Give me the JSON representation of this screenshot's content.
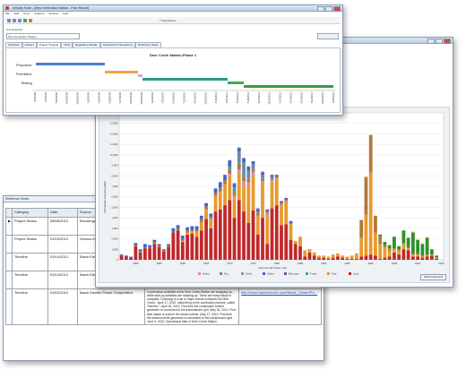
{
  "front_window": {
    "title": "Velocity Suite - [New Generation Station - Prior Report]",
    "menu": [
      "File",
      "Edit",
      "Tools",
      "Analysis",
      "Window",
      "Help"
    ],
    "toolbar": {
      "station_field": "New Generation Station",
      "help_label": "? Help Report"
    },
    "subtitle_label": "Unit Selected",
    "tabs": [
      "Overview",
      "Owners",
      "Project Timeline",
      "Units",
      "Regulatory Details",
      "Contracts & Transactions",
      "Reference Notes"
    ],
    "gantt": {
      "title": "Deer Creek Station-Phase 1",
      "rows": [
        "Proposed",
        "Permitted",
        "Testing"
      ],
      "dates": [
        "4/3/2008",
        "6/1/2008",
        "7/30/2008",
        "9/29/2008",
        "11/28/2008",
        "1/28/2009",
        "3/29/2009",
        "5/28/2009",
        "7/27/2009",
        "9/25/2009",
        "11/24/2009",
        "1/24/2010",
        "3/25/2010",
        "5/24/2010",
        "7/23/2010",
        "9/21/2010",
        "11/20/2010",
        "1/19/2011",
        "3/20/2011",
        "5/19/2011",
        "7/18/2011",
        "9/16/2011",
        "11/15/2011",
        "1/14/2012",
        "3/14/2012",
        "5/13/2012",
        "7/12/2012",
        "9/10/2012",
        "11/9/2012"
      ],
      "colors": {
        "proposed": "#4a7fd0",
        "permitted": "#eea24b",
        "permitted2": "#cfa7e0",
        "testing": "#2e9a8a",
        "testing2": "#3fae4a"
      }
    }
  },
  "back_window": {
    "chart_data": {
      "type": "bar",
      "ylabel": "Nameplate Capacity (MW)",
      "xlabel": "Commercial Online Year",
      "ylim": [
        0,
        14000
      ],
      "yticks": [
        0,
        1000,
        2000,
        3000,
        4000,
        5000,
        6000,
        7000,
        8000,
        9000,
        10000,
        11000,
        12000,
        13000,
        14000
      ],
      "xtick_labels": [
        "1950",
        "1955",
        "1960",
        "1965",
        "1970",
        "1975",
        "1980",
        "1985",
        "1990",
        "1995",
        "2000",
        "2005",
        "2010",
        "2015"
      ],
      "x": [
        1947,
        1948,
        1949,
        1950,
        1951,
        1952,
        1953,
        1954,
        1955,
        1956,
        1957,
        1958,
        1959,
        1960,
        1961,
        1962,
        1963,
        1964,
        1965,
        1966,
        1967,
        1968,
        1969,
        1970,
        1971,
        1972,
        1973,
        1974,
        1975,
        1976,
        1977,
        1978,
        1979,
        1980,
        1981,
        1982,
        1983,
        1984,
        1985,
        1986,
        1987,
        1988,
        1989,
        1990,
        1991,
        1992,
        1993,
        1994,
        1995,
        1996,
        1997,
        1998,
        1999,
        2000,
        2001,
        2002,
        2003,
        2004,
        2005,
        2006,
        2007,
        2008,
        2009,
        2010,
        2011,
        2012,
        2013,
        2014,
        2015
      ],
      "series": [
        {
          "name": "Coal",
          "color": "#c0282a",
          "values": [
            400,
            300,
            200,
            1300,
            700,
            1100,
            1100,
            1500,
            1200,
            800,
            1200,
            2600,
            2800,
            1700,
            2400,
            2500,
            2200,
            2800,
            3900,
            3000,
            4600,
            4800,
            5200,
            5700,
            4000,
            5700,
            4600,
            3500,
            4700,
            2400,
            4000,
            1500,
            4900,
            5200,
            3300,
            3400,
            1900,
            1500,
            1300,
            300,
            700,
            400,
            200,
            200,
            100,
            200,
            300,
            200,
            100,
            100,
            100,
            300,
            400,
            500,
            400,
            100,
            200,
            300,
            700,
            500,
            1000,
            900,
            300,
            300,
            200,
            300,
            400,
            100,
            0
          ]
        },
        {
          "name": "Gas",
          "color": "#e69a2e",
          "values": [
            0,
            0,
            0,
            0,
            0,
            0,
            0,
            0,
            0,
            0,
            0,
            0,
            0,
            100,
            200,
            200,
            500,
            800,
            900,
            900,
            1500,
            1700,
            2000,
            2300,
            1800,
            2500,
            2300,
            3500,
            3300,
            1800,
            3300,
            2600,
            2500,
            2600,
            2000,
            2200,
            1500,
            300,
            900,
            600,
            300,
            300,
            200,
            200,
            200,
            300,
            300,
            200,
            200,
            300,
            500,
            1800,
            3900,
            7800,
            2200,
            1400,
            1000,
            600,
            300,
            400,
            500,
            200,
            200,
            200,
            100,
            100,
            100,
            100,
            0
          ]
        },
        {
          "name": "Nuc",
          "color": "#d88f9a",
          "values": [
            0,
            0,
            0,
            0,
            0,
            0,
            0,
            0,
            0,
            0,
            0,
            0,
            0,
            0,
            0,
            0,
            0,
            0,
            0,
            0,
            0,
            0,
            0,
            200,
            300,
            400,
            600,
            400,
            400,
            0,
            200,
            300,
            200,
            0,
            0,
            0,
            0,
            0,
            0,
            0,
            0,
            0,
            0,
            0,
            0,
            0,
            0,
            0,
            0,
            0,
            0,
            0,
            0,
            0,
            0,
            0,
            0,
            0,
            0,
            0,
            0,
            0,
            0,
            0,
            0,
            0,
            0,
            0,
            0
          ]
        },
        {
          "name": "Oil",
          "color": "#b0783a",
          "values": [
            0,
            0,
            0,
            100,
            100,
            100,
            100,
            200,
            100,
            100,
            100,
            100,
            200,
            200,
            200,
            200,
            200,
            300,
            300,
            200,
            300,
            400,
            400,
            400,
            300,
            500,
            300,
            300,
            200,
            200,
            200,
            100,
            100,
            100,
            100,
            100,
            100,
            0,
            0,
            0,
            0,
            0,
            0,
            0,
            0,
            0,
            0,
            0,
            0,
            0,
            0,
            1700,
            3600,
            3600,
            1600,
            700,
            200,
            200,
            100,
            100,
            100,
            100,
            100,
            100,
            100,
            100,
            0,
            0,
            0
          ]
        },
        {
          "name": "Other",
          "color": "#6b8ca7",
          "values": [
            0,
            0,
            0,
            0,
            0,
            0,
            0,
            0,
            0,
            0,
            0,
            0,
            0,
            0,
            0,
            0,
            0,
            0,
            0,
            0,
            0,
            0,
            0,
            300,
            500,
            1200,
            1500,
            800,
            500,
            200,
            400,
            100,
            200,
            0,
            0,
            0,
            0,
            0,
            0,
            0,
            0,
            0,
            0,
            0,
            0,
            0,
            0,
            0,
            0,
            0,
            0,
            0,
            0,
            0,
            0,
            0,
            0,
            0,
            0,
            0,
            0,
            0,
            0,
            0,
            0,
            0,
            0,
            0,
            0
          ]
        },
        {
          "name": "Water",
          "color": "#3a66c8",
          "values": [
            100,
            100,
            100,
            200,
            200,
            300,
            200,
            200,
            200,
            100,
            200,
            300,
            300,
            300,
            300,
            300,
            300,
            300,
            300,
            300,
            400,
            400,
            400,
            500,
            300,
            300,
            300,
            300,
            200,
            200,
            200,
            100,
            100,
            100,
            100,
            100,
            100,
            0,
            0,
            0,
            0,
            0,
            0,
            0,
            0,
            0,
            0,
            0,
            0,
            0,
            0,
            0,
            0,
            0,
            0,
            0,
            0,
            0,
            0,
            0,
            0,
            0,
            0,
            0,
            0,
            0,
            0,
            0,
            0
          ]
        },
        {
          "name": "Biomass",
          "color": "#7e4f9e",
          "values": [
            0,
            0,
            0,
            0,
            0,
            0,
            0,
            0,
            0,
            0,
            0,
            0,
            0,
            0,
            0,
            0,
            0,
            0,
            0,
            0,
            0,
            100,
            100,
            100,
            100,
            100,
            100,
            100,
            100,
            100,
            100,
            100,
            100,
            100,
            100,
            100,
            100,
            0,
            0,
            0,
            0,
            0,
            0,
            0,
            0,
            0,
            0,
            0,
            0,
            0,
            0,
            0,
            0,
            0,
            0,
            0,
            0,
            0,
            0,
            0,
            0,
            0,
            0,
            0,
            0,
            0,
            0,
            0,
            0
          ]
        },
        {
          "name": "Wind",
          "color": "#2f8f2f",
          "values": [
            0,
            0,
            0,
            0,
            0,
            0,
            0,
            0,
            0,
            0,
            0,
            0,
            0,
            0,
            0,
            0,
            0,
            0,
            0,
            0,
            0,
            0,
            0,
            0,
            0,
            0,
            0,
            0,
            0,
            0,
            0,
            0,
            0,
            0,
            0,
            0,
            0,
            0,
            0,
            0,
            0,
            0,
            0,
            0,
            0,
            0,
            0,
            0,
            0,
            0,
            0,
            0,
            0,
            0,
            0,
            200,
            300,
            300,
            1100,
            300,
            1200,
            900,
            2000,
            1300,
            1100,
            1600,
            500,
            200,
            0
          ]
        },
        {
          "name": "Solar",
          "color": "#e8d64a",
          "values": [
            0,
            0,
            0,
            0,
            0,
            0,
            0,
            0,
            0,
            0,
            0,
            0,
            0,
            0,
            0,
            0,
            0,
            0,
            0,
            0,
            0,
            0,
            0,
            0,
            0,
            0,
            0,
            0,
            0,
            0,
            0,
            0,
            0,
            0,
            0,
            0,
            0,
            0,
            0,
            0,
            0,
            0,
            0,
            0,
            0,
            0,
            0,
            0,
            0,
            0,
            0,
            0,
            0,
            0,
            0,
            0,
            0,
            0,
            0,
            0,
            0,
            0,
            100,
            100,
            100,
            100,
            0,
            0,
            0
          ]
        }
      ],
      "legend_placement": "bottom"
    },
    "legend": [
      "Hydro",
      "Nuc",
      "Other",
      "Water",
      "Biomass",
      "Fuels",
      "Gas",
      "Coal"
    ],
    "legend_colors": [
      "#d888c8",
      "#6b8ca7",
      "#8b98a5",
      "#3a66c8",
      "#7e4f9e",
      "#4aa0c0",
      "#e69a2e",
      "#c0282a"
    ],
    "footer_button": "Show Data Grid"
  },
  "table_window": {
    "title": "Reference Notes",
    "columns": [
      "Category",
      "Date",
      "Source",
      "Notes",
      "Link"
    ],
    "rows": [
      {
        "category": "Project Status",
        "date": "08/08/2012",
        "source": "Brookings Regi",
        "notes": "",
        "link": ""
      },
      {
        "category": "Project Status",
        "date": "03/15/2012",
        "source": "Various Analyst",
        "notes": "",
        "link": ""
      },
      {
        "category": "Timeline",
        "date": "03/14/2012",
        "source": "Basin Electric Po",
        "notes": "",
        "link": ""
      },
      {
        "category": "Timeline",
        "date": "03/14/2012",
        "source": "Basin Electric P",
        "notes": "",
        "link": ""
      },
      {
        "category": "Timeline",
        "date": "03/02/2012",
        "source": "Basin Electric Power Cooperative",
        "notes": "Construction activities at the Deer Creek Station are wrapping up, while start-up activities are ramping-up. There are many steps to complete. Following is a list of major events scheduled at Deer Creek: -April 17, 2012: Initial firing of the combustion turbine, called \"first fire.\" -April 18, 2012: First time the combustion turbine generator is connected to the transmission grid -May 16, 2012: First time steam is used in the steam turbine -May 17, 2012: First time the steam turbine-generator is connected to the transmission grid -June 5, 2012: Operational date of Deer Creek Station.",
        "link": "http://www.basinelectric.com/News_Center/Pu..."
      }
    ]
  }
}
